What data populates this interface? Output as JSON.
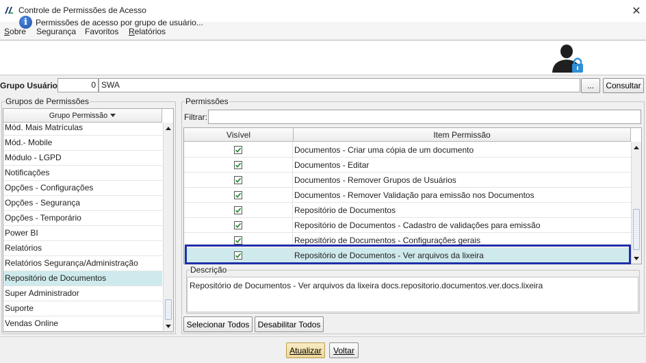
{
  "window": {
    "title": "Controle de Permissões de Acesso"
  },
  "menu": [
    {
      "label": "Sobre",
      "underline": "S",
      "rest": "obre"
    },
    {
      "label": "Segurança",
      "underline": "",
      "rest": "Segurança"
    },
    {
      "label": "Favoritos",
      "underline": "",
      "rest": "Favoritos"
    },
    {
      "label": "Relatórios",
      "underline": "R",
      "rest": "elatórios"
    }
  ],
  "banner": {
    "text": "Permissões de acesso por grupo de usuário..."
  },
  "grupo_usuario": {
    "label": "Grupo Usuário:",
    "code": "0",
    "name": "SWA",
    "ellipsis_label": "...",
    "consultar_label": "Consultar"
  },
  "grupos": {
    "title": "Grupos de Permissões",
    "column_header": "Grupo Permissão",
    "items": [
      "Mód. Mais Matrículas",
      "Mód.- Mobile",
      "Módulo - LGPD",
      "Notificações",
      "Opções - Configurações",
      "Opções - Segurança",
      "Opções - Temporário",
      "Power BI",
      "Relatórios",
      "Relatórios Segurança/Administração",
      "Repositório de Documentos",
      "Super Administrador",
      "Suporte",
      "Vendas Online"
    ],
    "selected_index": 10
  },
  "permissoes": {
    "title": "Permissões",
    "filter_label": "Filtrar:",
    "filter_value": "",
    "columns": {
      "visible": "Visível",
      "item": "Item Permissão"
    },
    "rows": [
      {
        "visible": true,
        "item": "Documentos - Criar uma cópia de um documento"
      },
      {
        "visible": true,
        "item": "Documentos - Editar"
      },
      {
        "visible": true,
        "item": "Documentos - Remover Grupos de Usuários"
      },
      {
        "visible": true,
        "item": "Documentos - Remover Validação para emissão nos Documentos"
      },
      {
        "visible": true,
        "item": "Repositório de Documentos"
      },
      {
        "visible": true,
        "item": "Repositório de Documentos - Cadastro de validações para emissão"
      },
      {
        "visible": true,
        "item": "Repositório de Documentos - Configurações gerais"
      },
      {
        "visible": true,
        "item": "Repositório de Documentos - Ver arquivos da lixeira"
      }
    ],
    "selected_index": 7
  },
  "descricao": {
    "title": "Descrição",
    "text": "Repositório de Documentos - Ver arquivos da lixeira docs.repositorio.documentos.ver.docs.lixeira"
  },
  "actions": {
    "selecionar_todos": "Selecionar Todos",
    "desabilitar_todos": "Desabilitar Todos",
    "atualizar": "Atualizar",
    "voltar": "Voltar"
  },
  "colors": {
    "selection": "#cfeaec",
    "highlight_border": "#1e2fa8",
    "check": "#2e8b3a",
    "primary_button": "#ecd79a"
  },
  "icons": [
    "app-logo-icon",
    "close-icon",
    "info-icon",
    "user-lock-icon",
    "sort-down-icon",
    "checkbox-checked-icon"
  ]
}
